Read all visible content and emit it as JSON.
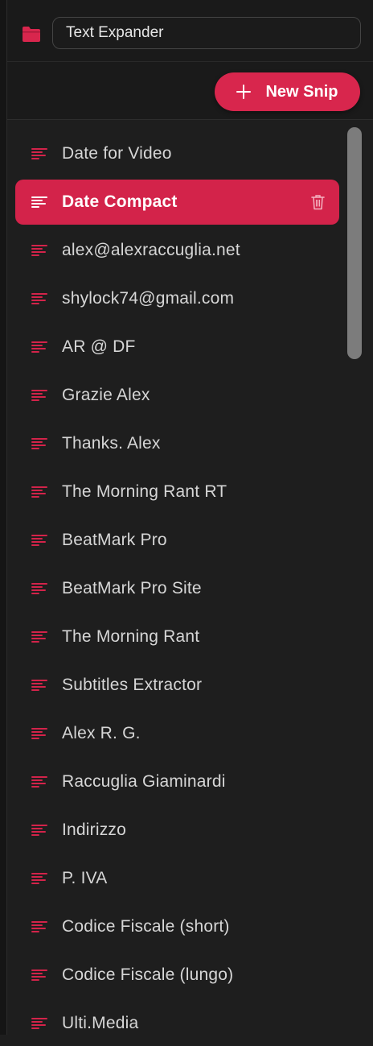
{
  "header": {
    "folder_icon": "folder-icon",
    "folder_name": "Text Expander",
    "new_snip_label": "New Snip"
  },
  "colors": {
    "accent": "#d3234a",
    "background": "#1e1e1e",
    "text": "#d6d6d6"
  },
  "snips": [
    {
      "label": "Date for Video",
      "selected": false
    },
    {
      "label": "Date Compact",
      "selected": true
    },
    {
      "label": "alex@alexraccuglia.net",
      "selected": false
    },
    {
      "label": "shylock74@gmail.com",
      "selected": false
    },
    {
      "label": "AR @ DF",
      "selected": false
    },
    {
      "label": "Grazie Alex",
      "selected": false
    },
    {
      "label": "Thanks. Alex",
      "selected": false
    },
    {
      "label": "The Morning Rant RT",
      "selected": false
    },
    {
      "label": "BeatMark Pro",
      "selected": false
    },
    {
      "label": "BeatMark Pro Site",
      "selected": false
    },
    {
      "label": "The Morning Rant",
      "selected": false
    },
    {
      "label": "Subtitles Extractor",
      "selected": false
    },
    {
      "label": "Alex R. G.",
      "selected": false
    },
    {
      "label": "Raccuglia Giaminardi",
      "selected": false
    },
    {
      "label": "Indirizzo",
      "selected": false
    },
    {
      "label": "P. IVA",
      "selected": false
    },
    {
      "label": "Codice Fiscale (short)",
      "selected": false
    },
    {
      "label": "Codice Fiscale (lungo)",
      "selected": false
    },
    {
      "label": "Ulti.Media",
      "selected": false
    }
  ]
}
